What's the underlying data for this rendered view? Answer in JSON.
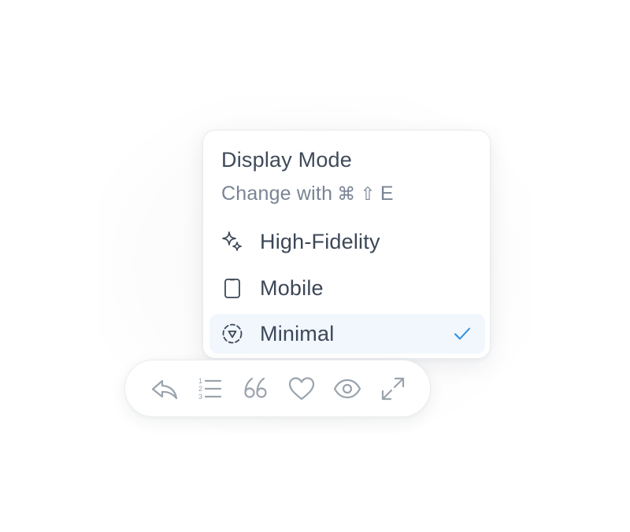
{
  "popover": {
    "title": "Display Mode",
    "subtitle_text": "Change with",
    "shortcut_keys": [
      "⌘",
      "⇧",
      "E"
    ],
    "items": [
      {
        "label": "High-Fidelity",
        "icon": "sparkle-icon",
        "selected": false
      },
      {
        "label": "Mobile",
        "icon": "phone-icon",
        "selected": false
      },
      {
        "label": "Minimal",
        "icon": "dashed-circle-icon",
        "selected": true
      }
    ]
  },
  "toolbar": {
    "buttons": [
      {
        "icon": "reply-icon"
      },
      {
        "icon": "numbered-list-icon"
      },
      {
        "icon": "quote-icon"
      },
      {
        "icon": "heart-icon"
      },
      {
        "icon": "eye-icon"
      },
      {
        "icon": "expand-icon"
      }
    ]
  },
  "colors": {
    "text_primary": "#3c4757",
    "text_secondary": "#7a8494",
    "selected_bg": "#f1f7fd",
    "check_accent": "#2d8fe0",
    "toolbar_icon": "#9aa3ad"
  }
}
